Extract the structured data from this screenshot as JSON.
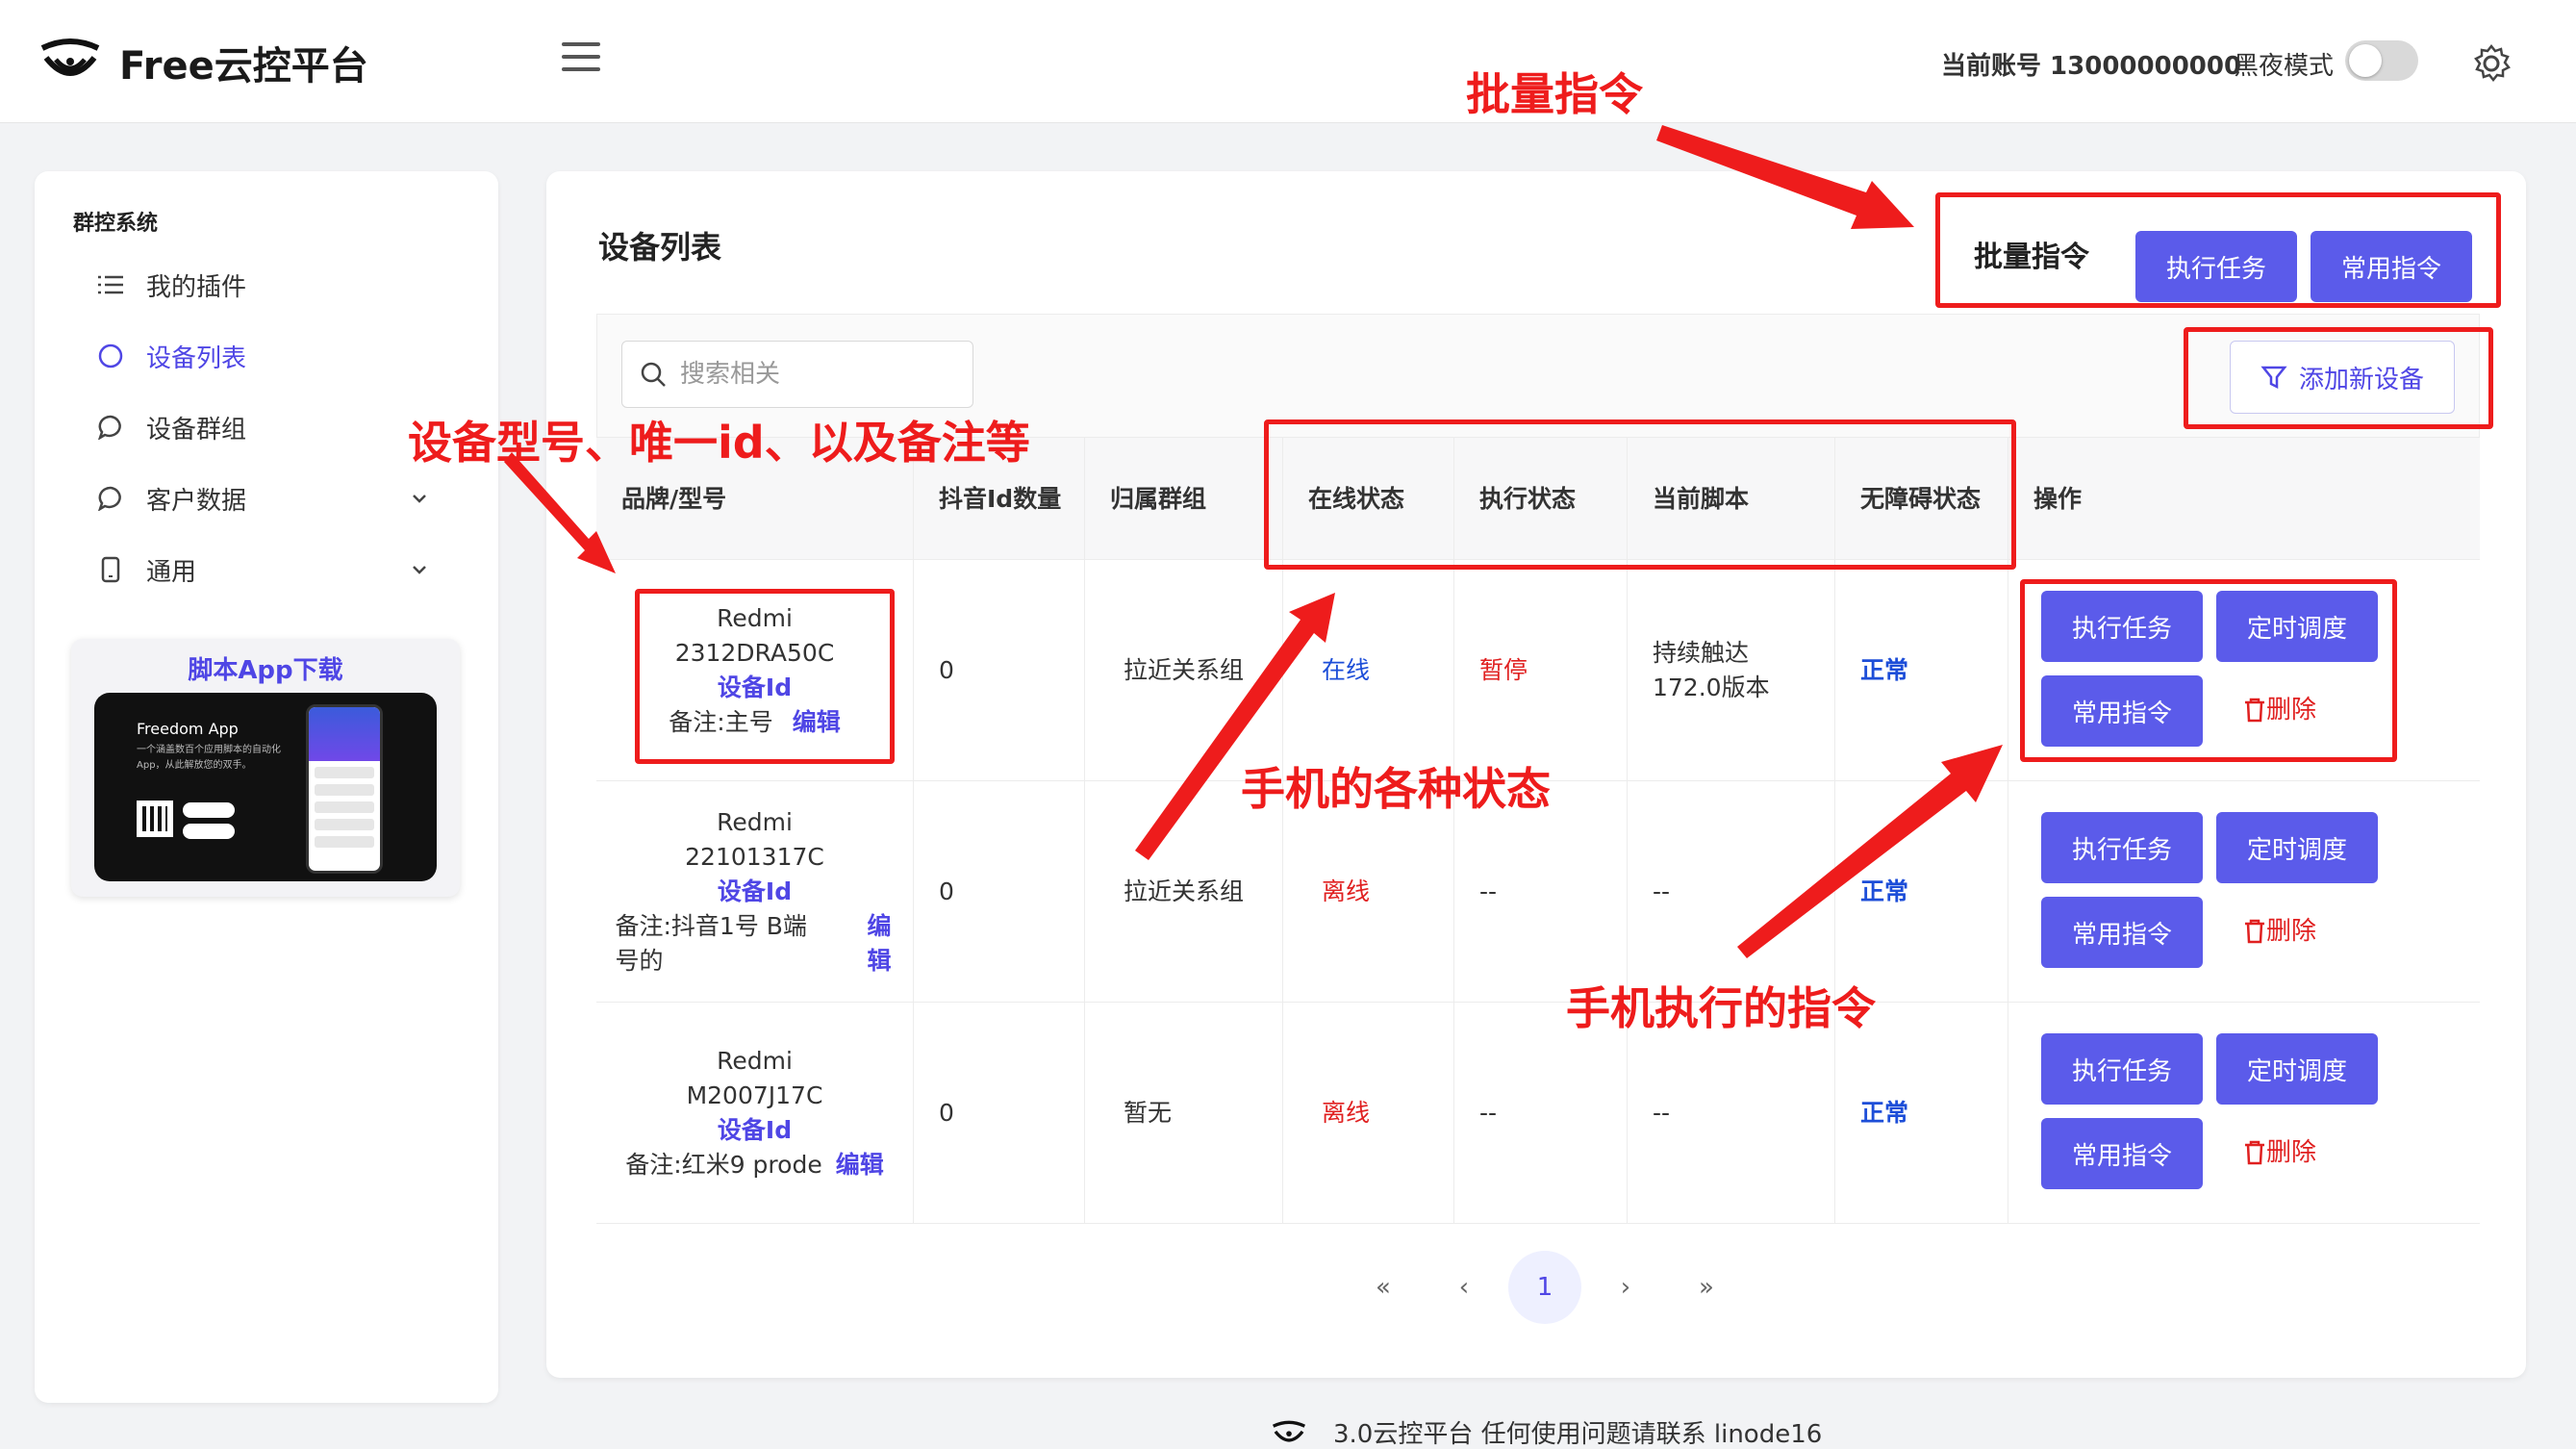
{
  "header": {
    "title": "Free云控平台",
    "account_text": "当前账号 13000000000",
    "dark_mode_label": "黑夜模式"
  },
  "sidebar": {
    "section": "群控系统",
    "items": [
      {
        "label": "我的插件",
        "icon": "list-icon"
      },
      {
        "label": "设备列表",
        "icon": "circle-icon",
        "active": true
      },
      {
        "label": "设备群组",
        "icon": "chat-icon"
      },
      {
        "label": "客户数据",
        "icon": "chat-icon",
        "expandable": true
      },
      {
        "label": "通用",
        "icon": "phone-icon",
        "expandable": true
      }
    ],
    "download": {
      "title": "脚本App下载",
      "app_name": "Freedom App",
      "app_desc": "一个涵盖数百个应用脚本的自动化App，从此解放您的双手。"
    }
  },
  "main": {
    "title": "设备列表",
    "batch_label": "批量指令",
    "batch_buttons": [
      "执行任务",
      "常用指令"
    ],
    "search_placeholder": "搜索相关",
    "add_device": "添加新设备",
    "columns": [
      "品牌/型号",
      "抖音Id数量",
      "归属群组",
      "在线状态",
      "执行状态",
      "当前脚本",
      "无障碍状态",
      "操作"
    ],
    "rows": [
      {
        "brand": "Redmi",
        "model": "2312DRA50C",
        "device_id": "设备Id",
        "note": "备注:主号",
        "edit": "编辑",
        "douyin_count": "0",
        "group": "拉近关系组",
        "online": "在线",
        "exec": "暂停",
        "script": "持续触达172.0版本",
        "accessibility": "正常"
      },
      {
        "brand": "Redmi",
        "model": "22101317C",
        "device_id": "设备Id",
        "note": "备注:抖音1号 B端号的",
        "edit": "编辑",
        "douyin_count": "0",
        "group": "拉近关系组",
        "online": "离线",
        "exec": "--",
        "script": "--",
        "accessibility": "正常"
      },
      {
        "brand": "Redmi",
        "model": "M2007J17C",
        "device_id": "设备Id",
        "note": "备注:红米9 prode",
        "edit": "编辑",
        "douyin_count": "0",
        "group": "暂无",
        "online": "离线",
        "exec": "--",
        "script": "--",
        "accessibility": "正常"
      }
    ],
    "row_actions": {
      "run": "执行任务",
      "schedule": "定时调度",
      "common": "常用指令",
      "delete": "删除"
    },
    "pagination": {
      "first": "«",
      "prev": "‹",
      "current": "1",
      "next": "›",
      "last": "»"
    }
  },
  "footer": {
    "text": "3.0云控平台 任何使用问题请联系 linode16"
  },
  "annotations": {
    "batch": "批量指令",
    "device_info": "设备型号、唯一id、以及备注等",
    "status": "手机的各种状态",
    "commands": "手机执行的指令"
  },
  "colors": {
    "accent": "#5b5bea",
    "annotation": "#ee1c1c",
    "offline": "#e02020",
    "online": "#1d4ed8"
  }
}
